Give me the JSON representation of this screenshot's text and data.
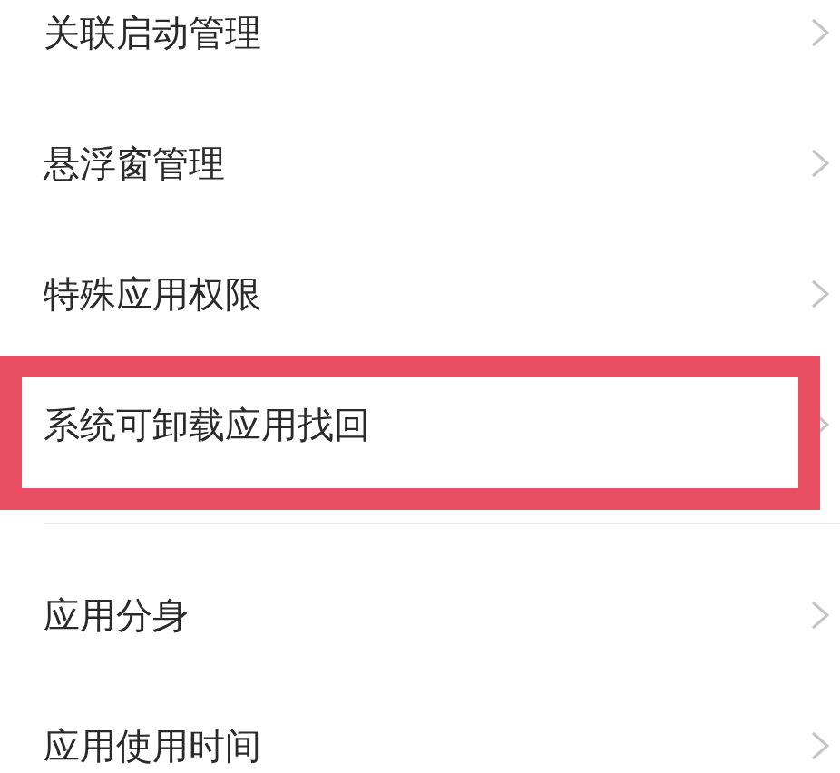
{
  "sections": [
    {
      "items": [
        {
          "label": "关联启动管理",
          "highlighted": false
        },
        {
          "label": "悬浮窗管理",
          "highlighted": false
        },
        {
          "label": "特殊应用权限",
          "highlighted": false
        },
        {
          "label": "系统可卸载应用找回",
          "highlighted": true
        }
      ]
    },
    {
      "items": [
        {
          "label": "应用分身",
          "highlighted": false
        },
        {
          "label": "应用使用时间",
          "highlighted": false
        }
      ]
    }
  ]
}
